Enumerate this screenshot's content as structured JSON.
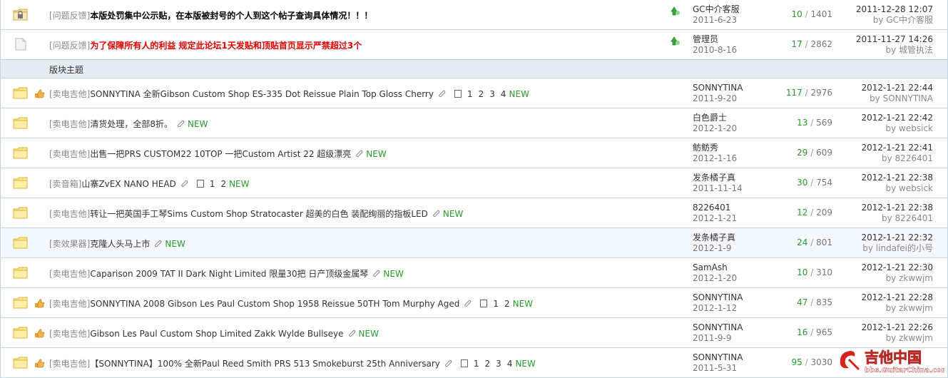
{
  "section_label": "版块主题",
  "colors": {
    "reply": "#2a9b2a",
    "red_title": "#e00000",
    "new": "#2a9b2a"
  },
  "sticky": [
    {
      "icon": "lock-folder-icon",
      "type": "[问题反馈]",
      "title": "本版处罚集中公示贴，在本版被封号的个人到这个帖子查询具体情况！！！",
      "style": "bold",
      "author": "GC中介客服",
      "author_date": "2011-6-23",
      "replies": "10",
      "views": "1401",
      "last_time": "2011-12-28 12:07",
      "last_by": "by GC中介客服"
    },
    {
      "icon": "doc-icon",
      "type": "[问题反馈]",
      "title": "为了保障所有人的利益 规定此论坛1天发贴和顶贴首页显示严禁超过3个",
      "style": "red",
      "author": "管理员",
      "author_date": "2010-8-16",
      "replies": "17",
      "views": "2862",
      "last_time": "2011-11-27 14:26",
      "last_by": "by 城管执法"
    }
  ],
  "threads": [
    {
      "hand": true,
      "type": "[卖电吉他]",
      "title": "SONNYTINA 全新Gibson Custom Shop ES-335 Dot Reissue Plain Top Gloss Cherry",
      "clip": true,
      "pages": [
        "1",
        "2",
        "3",
        "4"
      ],
      "new": "NEW",
      "author": "SONNYTINA",
      "author_date": "2011-9-20",
      "replies": "117",
      "views": "2976",
      "last_time": "2012-1-21 22:44",
      "last_by": "by SONNYTINA"
    },
    {
      "hand": false,
      "type": "[卖电吉他]",
      "title": "清货处理，全部8折。",
      "clip": true,
      "pages": [],
      "new": "NEW",
      "author": "白色爵士",
      "author_date": "2012-1-20",
      "replies": "13",
      "views": "569",
      "last_time": "2012-1-21 22:42",
      "last_by": "by websick"
    },
    {
      "hand": false,
      "type": "[卖电吉他]",
      "title": "出售一把PRS CUSTOM22 10TOP 一把Custom Artist 22 超级漂亮",
      "clip": true,
      "pages": [],
      "new": "NEW",
      "author": "鲂鲂秀",
      "author_date": "2012-1-16",
      "replies": "29",
      "views": "609",
      "last_time": "2012-1-21 22:41",
      "last_by": "by 8226401"
    },
    {
      "hand": false,
      "type": "[卖音箱]",
      "title": "山寨ZvEX NANO HEAD",
      "clip": true,
      "pages": [
        "1",
        "2"
      ],
      "new": "NEW",
      "author": "发条橘子真",
      "author_date": "2011-11-14",
      "replies": "30",
      "views": "754",
      "last_time": "2012-1-21 22:38",
      "last_by": "by websick"
    },
    {
      "hand": false,
      "type": "[卖电吉他]",
      "title": "转让一把英国手工琴Sims Custom Shop Stratocaster 超美的白色 装配绚丽的指板LED",
      "clip": true,
      "pages": [],
      "new": "NEW",
      "author": "8226401",
      "author_date": "2012-1-21",
      "replies": "12",
      "views": "209",
      "last_time": "2012-1-21 22:38",
      "last_by": "by 8226401"
    },
    {
      "hand": false,
      "type": "[卖效果器]",
      "title": "克隆人头马上市",
      "clip": true,
      "pages": [],
      "new": "NEW",
      "author": "发条橘子真",
      "author_date": "2012-1-9",
      "replies": "24",
      "views": "801",
      "last_time": "2012-1-21 22:32",
      "last_by": "by lindafei的小号",
      "alt": true
    },
    {
      "hand": false,
      "type": "[卖电吉他]",
      "title": "Caparison 2009 TAT II Dark Night Limited 限量30把 日产顶级金属琴",
      "clip": true,
      "pages": [],
      "new": "NEW",
      "author": "SamAsh",
      "author_date": "2012-1-20",
      "replies": "10",
      "views": "310",
      "last_time": "2012-1-21 22:30",
      "last_by": "by zkwwjm"
    },
    {
      "hand": true,
      "type": "[卖电吉他]",
      "title": "SONNYTINA 2008 Gibson Les Paul Custom Shop 1958 Reissue 50TH Tom Murphy Aged",
      "clip": true,
      "pages": [
        "1",
        "2"
      ],
      "new": "NEW",
      "author": "SONNYTINA",
      "author_date": "2012-1-12",
      "replies": "47",
      "views": "835",
      "last_time": "2012-1-21 22:28",
      "last_by": "by zkwwjm"
    },
    {
      "hand": true,
      "type": "[卖电吉他]",
      "title": "Gibson Les Paul Custom Shop Limited Zakk Wylde Bullseye",
      "clip": true,
      "pages": [],
      "new": "NEW",
      "author": "SONNYTINA",
      "author_date": "2011-9-9",
      "replies": "16",
      "views": "965",
      "last_time": "2012-1-21 22:26",
      "last_by": "by zkwwjm"
    },
    {
      "hand": true,
      "type": "[卖电吉他]",
      "title": "【SONNYTINA】100% 全新Paul Reed Smith PRS 513 Smokeburst 25th Anniversary",
      "clip": true,
      "pages": [
        "1",
        "2",
        "3",
        "4"
      ],
      "new": "NEW",
      "author": "SONNYTINA",
      "author_date": "2011-5-31",
      "replies": "95",
      "views": "3030",
      "last_time": "",
      "last_by": ""
    }
  ],
  "watermark": {
    "title": "吉他中国",
    "url": "bbs.GuitarChina.com"
  }
}
